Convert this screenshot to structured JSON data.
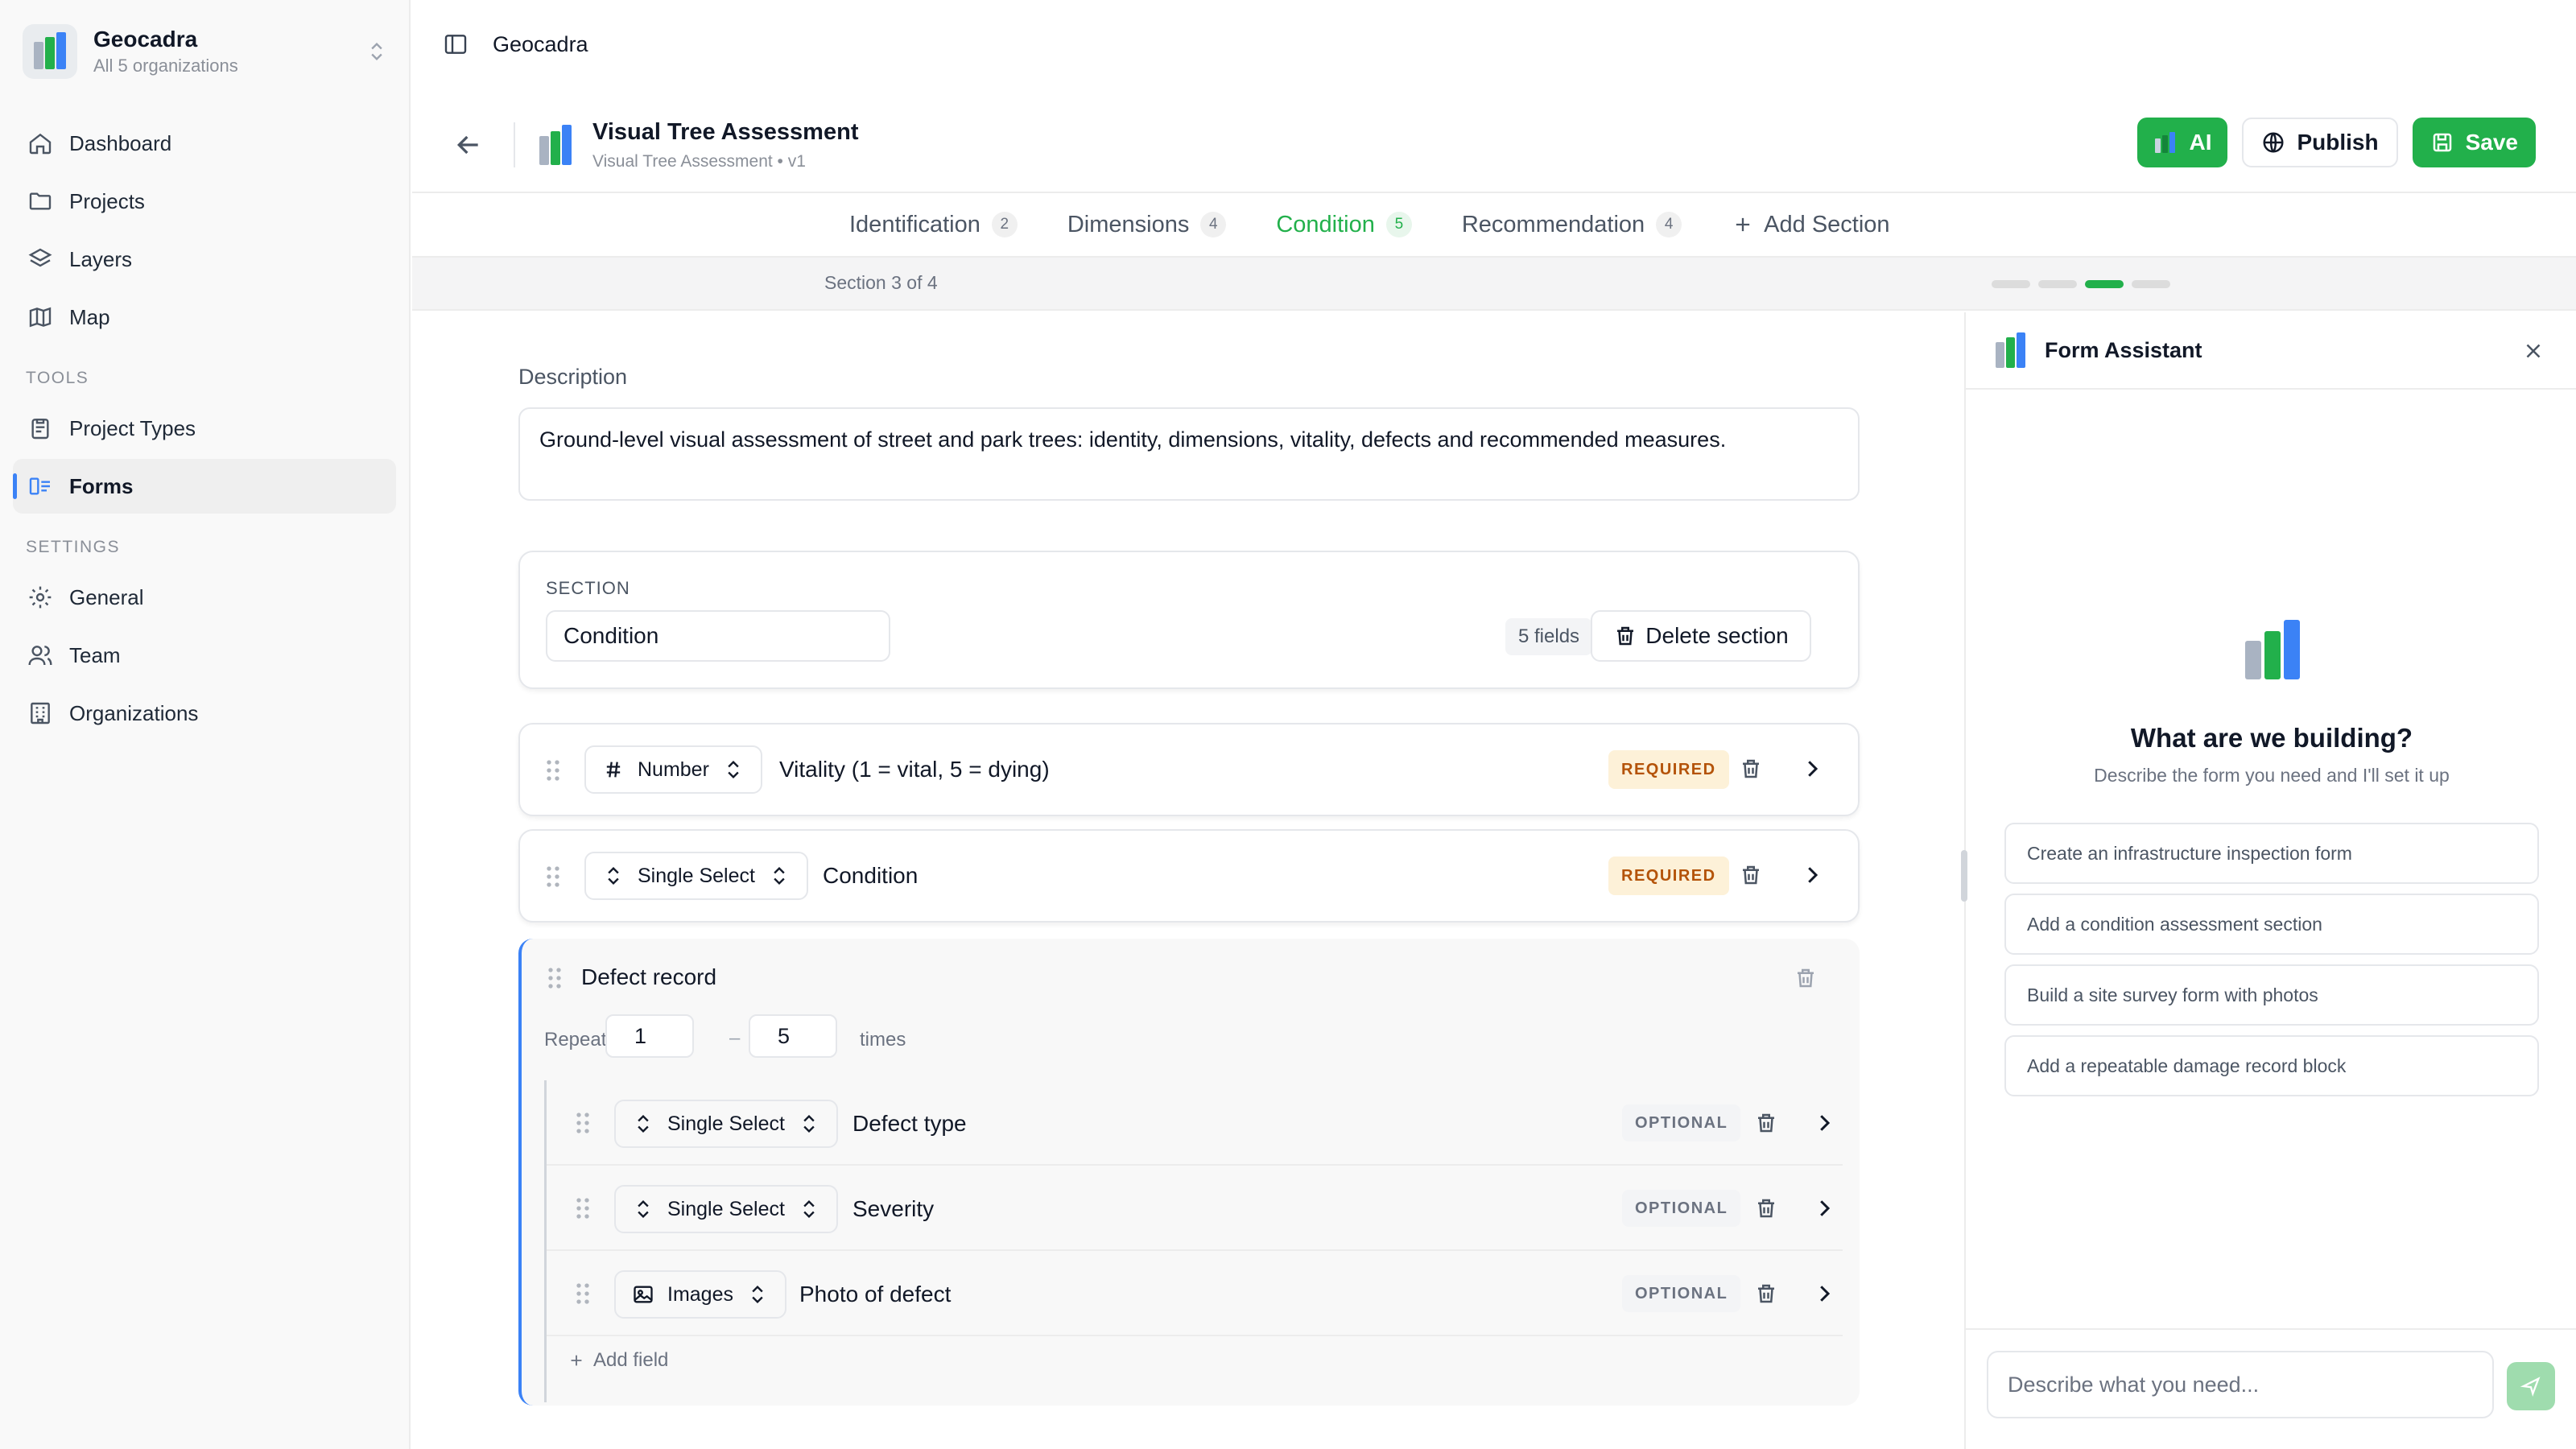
{
  "sidebar": {
    "org_name": "Geocadra",
    "org_sub": "All 5 organizations",
    "nav": [
      {
        "label": "Dashboard",
        "icon": "home-icon"
      },
      {
        "label": "Projects",
        "icon": "folder-icon"
      },
      {
        "label": "Layers",
        "icon": "layers-icon"
      },
      {
        "label": "Map",
        "icon": "map-icon"
      }
    ],
    "tools_heading": "TOOLS",
    "tools": [
      {
        "label": "Project Types",
        "icon": "clipboard-icon"
      },
      {
        "label": "Forms",
        "icon": "form-icon",
        "active": true
      }
    ],
    "settings_heading": "SETTINGS",
    "settings": [
      {
        "label": "General",
        "icon": "gear-icon"
      },
      {
        "label": "Team",
        "icon": "users-icon"
      },
      {
        "label": "Organizations",
        "icon": "building-icon"
      }
    ]
  },
  "topbar": {
    "breadcrumb": "Geocadra"
  },
  "header": {
    "title": "Visual Tree Assessment",
    "subtitle": "Visual Tree Assessment • v1",
    "ai_label": "AI",
    "publish_label": "Publish",
    "save_label": "Save"
  },
  "tabs": [
    {
      "label": "Identification",
      "count": "2"
    },
    {
      "label": "Dimensions",
      "count": "4"
    },
    {
      "label": "Condition",
      "count": "5",
      "active": true
    },
    {
      "label": "Recommendation",
      "count": "4"
    }
  ],
  "add_section_label": "Add Section",
  "progress": {
    "label": "Section 3 of 4",
    "current": 3,
    "total": 4
  },
  "description": {
    "label": "Description",
    "value": "Ground-level visual assessment of street and park trees: identity, dimensions, vitality, defects and recommended measures."
  },
  "section": {
    "label": "SECTION",
    "name": "Condition",
    "fields_count": "5 fields",
    "delete_label": "Delete section"
  },
  "fields": [
    {
      "type": "Number",
      "type_icon": "hash-icon",
      "name": "Vitality (1 = vital, 5 = dying)",
      "badge": "REQUIRED"
    },
    {
      "type": "Single Select",
      "type_icon": "select-icon",
      "name": "Condition",
      "badge": "REQUIRED"
    }
  ],
  "group": {
    "title": "Defect record",
    "repeats_label": "Repeats",
    "min": "1",
    "max": "5",
    "times_label": "times",
    "fields": [
      {
        "type": "Single Select",
        "type_icon": "select-icon",
        "name": "Defect type",
        "badge": "OPTIONAL"
      },
      {
        "type": "Single Select",
        "type_icon": "select-icon",
        "name": "Severity",
        "badge": "OPTIONAL"
      },
      {
        "type": "Images",
        "type_icon": "image-icon",
        "name": "Photo of defect",
        "badge": "OPTIONAL"
      }
    ],
    "add_field_label": "Add field"
  },
  "assistant": {
    "title": "Form Assistant",
    "heading": "What are we building?",
    "subheading": "Describe the form you need and I'll set it up",
    "suggestions": [
      "Create an infrastructure inspection form",
      "Add a condition assessment section",
      "Build a site survey form with photos",
      "Add a repeatable damage record block"
    ],
    "input_placeholder": "Describe what you need..."
  },
  "colors": {
    "accent": "#22b04b",
    "active_nav": "#3b82f6",
    "required_bg": "#fdf1d8",
    "required_text": "#b45309"
  }
}
